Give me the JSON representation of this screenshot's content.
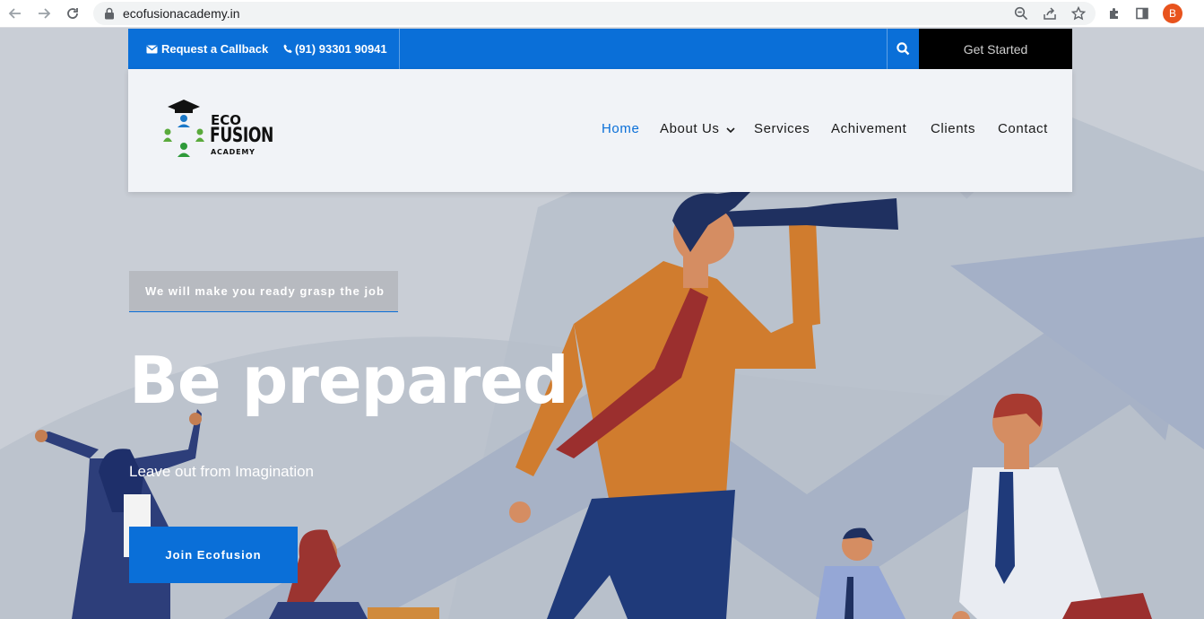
{
  "browser": {
    "url": "ecofusionacademy.in",
    "profile_initial": "B",
    "icons": [
      "back-icon",
      "forward-icon",
      "reload-icon",
      "lock-icon",
      "zoom-icon",
      "share-icon",
      "star-icon",
      "extensions-icon",
      "sidepanel-icon"
    ]
  },
  "topbar": {
    "callback_label": "Request a Callback",
    "phone_label": "(91) 93301 90941",
    "get_started_label": "Get Started",
    "color": "#0a6fd8"
  },
  "logo": {
    "line1": "ECO",
    "line2": "FUSION",
    "line3": "ACADEMY"
  },
  "nav": {
    "items": [
      {
        "label": "Home",
        "active": true
      },
      {
        "label": "About Us",
        "dropdown": true
      },
      {
        "label": "Services"
      },
      {
        "label": "Achivement"
      },
      {
        "label": "Clients"
      },
      {
        "label": "Contact"
      }
    ],
    "active_color": "#0a6fd8"
  },
  "hero": {
    "tagline": "We will make you ready grasp the job",
    "headline": "Be prepared",
    "subline": "Leave out from Imagination",
    "cta_label": "Join Ecofusion"
  }
}
